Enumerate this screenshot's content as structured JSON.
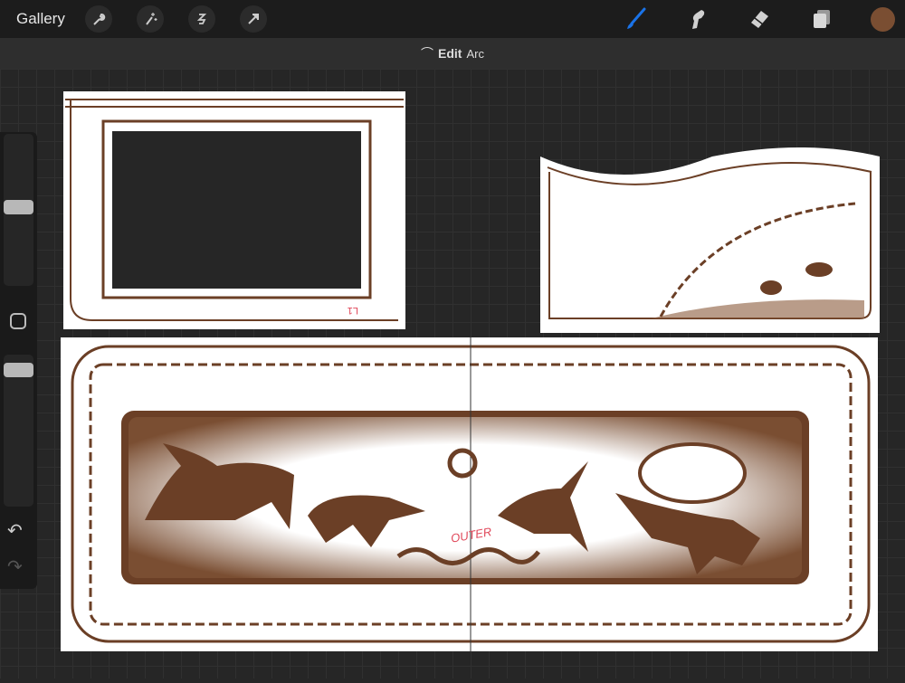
{
  "topbar": {
    "gallery": "Gallery",
    "left_tools": [
      "wrench-icon",
      "magic-wand-icon",
      "selection-icon",
      "transform-arrow-icon"
    ],
    "right_tools": [
      "brush-icon",
      "smudge-icon",
      "eraser-icon",
      "layers-icon"
    ],
    "active_tool": "brush",
    "accent": "#1a73e8",
    "current_color": "#7a4e32"
  },
  "modebar": {
    "edit": "Edit",
    "shape": "Arc"
  },
  "sidebar": {
    "brush_size": 0.52,
    "opacity": 0.94,
    "undo": "↶",
    "redo": "↷"
  },
  "artwork": {
    "annotation_l1": "L1",
    "annotation_outer": "OUTER",
    "ink": "#6b3f26",
    "annotation_color": "#e0485a"
  }
}
